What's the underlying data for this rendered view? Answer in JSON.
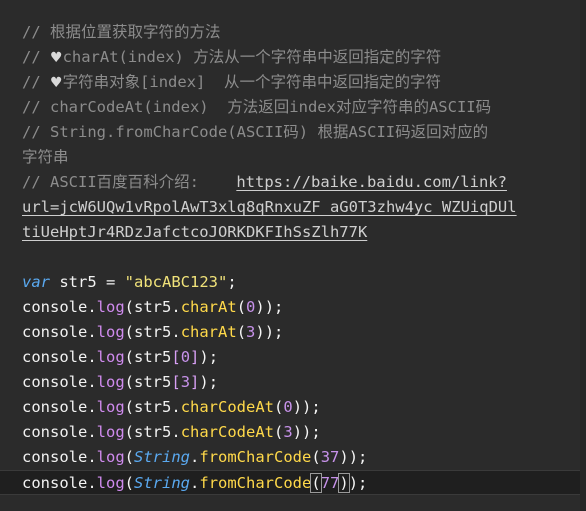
{
  "editor": {
    "comments": {
      "l1": "// 根据位置获取字符的方法",
      "l2_prefix": "// ",
      "l2_text": "charAt(index) 方法从一个字符串中返回指定的字符",
      "l3_prefix": "// ",
      "l3_text": "字符串对象[index]  从一个字符串中返回指定的字符",
      "l4": "// charCodeAt(index)  方法返回index对应字符串的ASCII码",
      "l5": "// String.fromCharCode(ASCII码) 根据ASCII码返回对应的",
      "l6": "字符串",
      "l7_prefix": "// ASCII百度百科介绍:    ",
      "link_part1": "https://baike.baidu.com/link?",
      "link_part2": "url=jcW6UQw1vRpolAwT3xlq8qRnxuZF_aG0T3zhw4yc_WZUiqDUl",
      "link_part3": "tiUeHptJr4RDzJafctcoJORKDKFIhSsZlh77K"
    },
    "code": {
      "var_kw": "var",
      "var_name": "str5",
      "assign": " = ",
      "string_literal": "\"abcABC123\"",
      "semicolon": ";",
      "console": "console",
      "dot": ".",
      "log": "log",
      "open": "(",
      "close": ")",
      "close_semi": ");",
      "str_obj": "str5",
      "charAt": "charAt",
      "charCodeAt": "charCodeAt",
      "String": "String",
      "fromCharCode": "fromCharCode",
      "lb": "[",
      "rb": "]",
      "n0": "0",
      "n3": "3",
      "n37": "37",
      "n77": "77"
    }
  }
}
